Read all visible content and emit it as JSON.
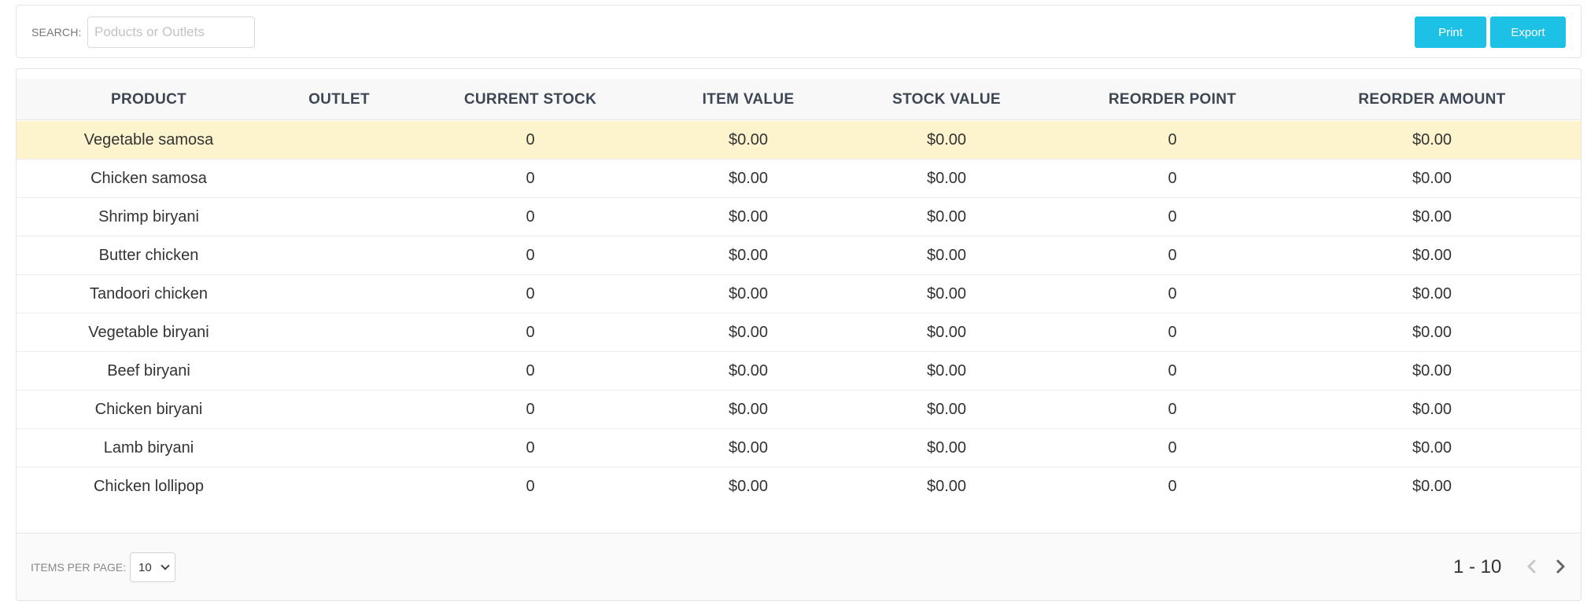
{
  "search": {
    "label": "SEARCH:",
    "placeholder": "Poducts or Outlets",
    "value": ""
  },
  "actions": {
    "print_label": "Print",
    "export_label": "Export",
    "accent_color": "#1dc1e6"
  },
  "table": {
    "columns": [
      "PRODUCT",
      "OUTLET",
      "CURRENT STOCK",
      "ITEM VALUE",
      "STOCK VALUE",
      "REORDER POINT",
      "REORDER AMOUNT"
    ],
    "highlight_color": "#fdf4cd",
    "rows": [
      {
        "product": "Vegetable samosa",
        "outlet": "",
        "current_stock": "0",
        "item_value": "$0.00",
        "stock_value": "$0.00",
        "reorder_point": "0",
        "reorder_amount": "$0.00"
      },
      {
        "product": "Chicken samosa",
        "outlet": "",
        "current_stock": "0",
        "item_value": "$0.00",
        "stock_value": "$0.00",
        "reorder_point": "0",
        "reorder_amount": "$0.00"
      },
      {
        "product": "Shrimp biryani",
        "outlet": "",
        "current_stock": "0",
        "item_value": "$0.00",
        "stock_value": "$0.00",
        "reorder_point": "0",
        "reorder_amount": "$0.00"
      },
      {
        "product": "Butter chicken",
        "outlet": "",
        "current_stock": "0",
        "item_value": "$0.00",
        "stock_value": "$0.00",
        "reorder_point": "0",
        "reorder_amount": "$0.00"
      },
      {
        "product": "Tandoori chicken",
        "outlet": "",
        "current_stock": "0",
        "item_value": "$0.00",
        "stock_value": "$0.00",
        "reorder_point": "0",
        "reorder_amount": "$0.00"
      },
      {
        "product": "Vegetable biryani",
        "outlet": "",
        "current_stock": "0",
        "item_value": "$0.00",
        "stock_value": "$0.00",
        "reorder_point": "0",
        "reorder_amount": "$0.00"
      },
      {
        "product": "Beef biryani",
        "outlet": "",
        "current_stock": "0",
        "item_value": "$0.00",
        "stock_value": "$0.00",
        "reorder_point": "0",
        "reorder_amount": "$0.00"
      },
      {
        "product": "Chicken biryani",
        "outlet": "",
        "current_stock": "0",
        "item_value": "$0.00",
        "stock_value": "$0.00",
        "reorder_point": "0",
        "reorder_amount": "$0.00"
      },
      {
        "product": "Lamb biryani",
        "outlet": "",
        "current_stock": "0",
        "item_value": "$0.00",
        "stock_value": "$0.00",
        "reorder_point": "0",
        "reorder_amount": "$0.00"
      },
      {
        "product": "Chicken lollipop",
        "outlet": "",
        "current_stock": "0",
        "item_value": "$0.00",
        "stock_value": "$0.00",
        "reorder_point": "0",
        "reorder_amount": "$0.00"
      }
    ]
  },
  "pagination": {
    "items_per_page_label": "ITEMS PER PAGE:",
    "items_per_page_value": "10",
    "range_text": "1 - 10",
    "prev_icon": "chevron-left-icon",
    "next_icon": "chevron-right-icon"
  }
}
